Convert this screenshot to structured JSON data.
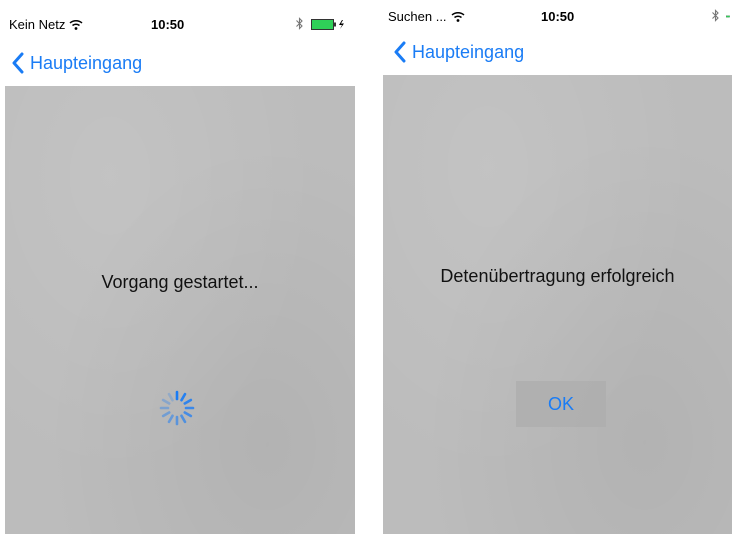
{
  "screens": [
    {
      "status": {
        "carrier": "Kein Netz",
        "time": "10:50"
      },
      "nav": {
        "back_label": "Haupteingang"
      },
      "message": "Vorgang gestartet..."
    },
    {
      "status": {
        "carrier": "Suchen ...",
        "time": "10:50"
      },
      "nav": {
        "back_label": "Haupteingang"
      },
      "message": "Detenübertragung erfolgreich",
      "button_label": "OK"
    }
  ],
  "colors": {
    "accent": "#1a7cf5",
    "background": "#bcbcbc",
    "battery": "#2fd058"
  },
  "icons": [
    "wifi-icon",
    "bluetooth-icon",
    "battery-icon",
    "chevron-left-icon",
    "spinner-icon"
  ]
}
